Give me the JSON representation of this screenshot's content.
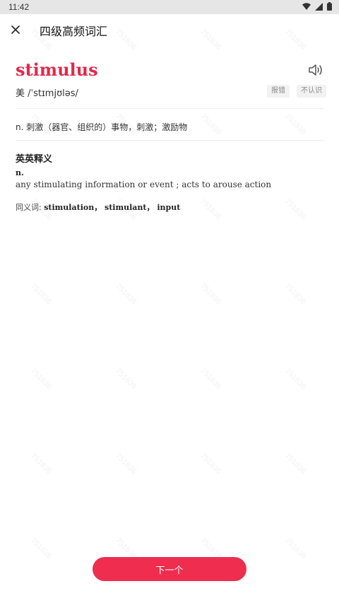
{
  "status_bar": {
    "time": "11:42",
    "icons": [
      "wifi-icon",
      "signal-icon",
      "battery-icon"
    ]
  },
  "header": {
    "title": "四级高频词汇",
    "close_icon": "close-icon"
  },
  "word": {
    "text": "stimulus",
    "color": "#e3284b",
    "phonetic_label": "美",
    "phonetic": "/ˈstɪmjʊləs/",
    "report_label": "报错",
    "unknown_label": "不认识"
  },
  "definition_cn": "n. 刺激（器官、组织的）事物，刺激；激励物",
  "en_section": {
    "title": "英英释义",
    "pos": "n.",
    "definition": "any stimulating information or event ; acts to arouse action",
    "synonyms_label": "同义词:",
    "synonyms": "stimulation， stimulant， input"
  },
  "next_button": {
    "label": "下一个",
    "color": "#ee2d4f"
  },
  "watermark": "751836"
}
